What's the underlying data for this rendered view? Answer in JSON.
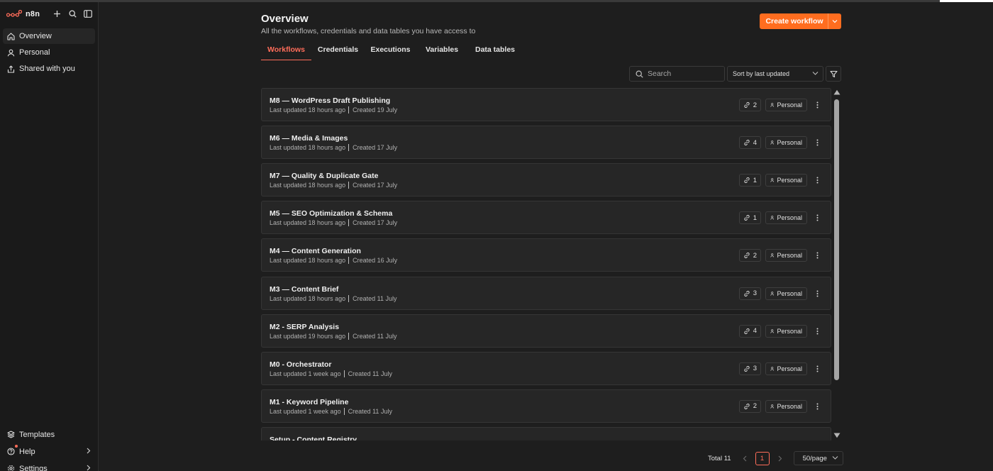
{
  "brand": {
    "name": "n8n"
  },
  "sidebar": {
    "items": [
      {
        "label": "Overview",
        "icon": "home-icon"
      },
      {
        "label": "Personal",
        "icon": "user-icon"
      },
      {
        "label": "Shared with you",
        "icon": "share-icon"
      }
    ],
    "bottom": [
      {
        "label": "Templates",
        "icon": "templates-icon"
      },
      {
        "label": "Help",
        "icon": "help-icon"
      },
      {
        "label": "Settings",
        "icon": "gear-icon"
      }
    ]
  },
  "header": {
    "title": "Overview",
    "subtitle": "All the workflows, credentials and data tables you have access to",
    "create_label": "Create workflow"
  },
  "tabs": [
    {
      "label": "Workflows",
      "active": true
    },
    {
      "label": "Credentials",
      "active": false
    },
    {
      "label": "Executions",
      "active": false
    },
    {
      "label": "Variables",
      "active": false
    },
    {
      "label": "Data tables",
      "active": false
    }
  ],
  "search": {
    "placeholder": "Search",
    "value": ""
  },
  "sort": {
    "selected": "Sort by last updated"
  },
  "workflows": [
    {
      "name": "M8 — WordPress Draft Publishing",
      "updated": "Last updated 18 hours ago",
      "created": "Created 19 July",
      "credentials": "2",
      "owner": "Personal"
    },
    {
      "name": "M6 — Media & Images",
      "updated": "Last updated 18 hours ago",
      "created": "Created 17 July",
      "credentials": "4",
      "owner": "Personal"
    },
    {
      "name": "M7 — Quality & Duplicate Gate",
      "updated": "Last updated 18 hours ago",
      "created": "Created 17 July",
      "credentials": "1",
      "owner": "Personal"
    },
    {
      "name": "M5 — SEO Optimization & Schema",
      "updated": "Last updated 18 hours ago",
      "created": "Created 17 July",
      "credentials": "1",
      "owner": "Personal"
    },
    {
      "name": "M4 — Content Generation",
      "updated": "Last updated 18 hours ago",
      "created": "Created 16 July",
      "credentials": "2",
      "owner": "Personal"
    },
    {
      "name": "M3 — Content Brief",
      "updated": "Last updated 18 hours ago",
      "created": "Created 11 July",
      "credentials": "3",
      "owner": "Personal"
    },
    {
      "name": "M2 - SERP Analysis",
      "updated": "Last updated 19 hours ago",
      "created": "Created 11 July",
      "credentials": "4",
      "owner": "Personal"
    },
    {
      "name": "M0 - Orchestrator",
      "updated": "Last updated 1 week ago",
      "created": "Created 11 July",
      "credentials": "3",
      "owner": "Personal"
    },
    {
      "name": "M1 - Keyword Pipeline",
      "updated": "Last updated 1 week ago",
      "created": "Created 11 July",
      "credentials": "2",
      "owner": "Personal"
    },
    {
      "name": "Setup - Content Registry",
      "updated": "",
      "created": "",
      "credentials": "",
      "owner": ""
    }
  ],
  "pagination": {
    "total": "Total 11",
    "current_page": "1",
    "per_page": "50/page"
  },
  "colors": {
    "accent": "#ff6d5a",
    "primary_button": "#ff6d1f",
    "background": "#1e1e1e",
    "card": "#262626"
  }
}
